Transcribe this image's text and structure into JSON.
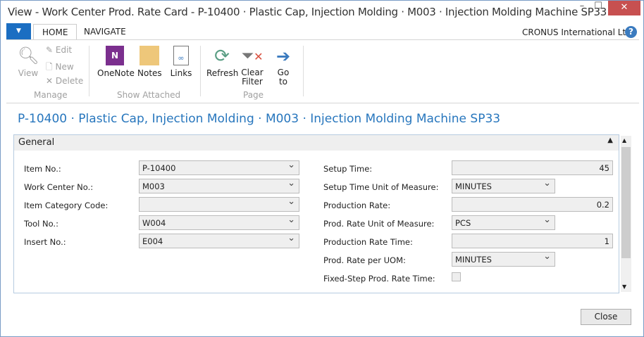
{
  "window": {
    "title": "View - Work Center Prod. Rate Card - P-10400 · Plastic Cap, Injection Molding · M003 · Injection Molding Machine SP33"
  },
  "ribbon": {
    "tabs": [
      "HOME",
      "NAVIGATE"
    ],
    "company": "CRONUS International Ltd.",
    "manage": {
      "view": "View",
      "edit": "Edit",
      "new": "New",
      "delete": "Delete",
      "group": "Manage"
    },
    "attached": {
      "onenote": "OneNote",
      "notes": "Notes",
      "links": "Links",
      "group": "Show Attached"
    },
    "page": {
      "refresh": "Refresh",
      "clear1": "Clear",
      "clear2": "Filter",
      "go1": "Go",
      "go2": "to",
      "group": "Page"
    }
  },
  "page_title": "P-10400 · Plastic Cap, Injection Molding · M003 · Injection Molding Machine SP33",
  "general": {
    "header": "General",
    "left": [
      {
        "label": "Item No.:",
        "value": "P-10400"
      },
      {
        "label": "Work Center No.:",
        "value": "M003"
      },
      {
        "label": "Item Category Code:",
        "value": ""
      },
      {
        "label": "Tool No.:",
        "value": "W004"
      },
      {
        "label": "Insert No.:",
        "value": "E004"
      }
    ],
    "right": [
      {
        "label": "Setup Time:",
        "value": "45"
      },
      {
        "label": "Setup Time Unit of Measure:",
        "value": "MINUTES"
      },
      {
        "label": "Production Rate:",
        "value": "0.2"
      },
      {
        "label": "Prod. Rate Unit of Measure:",
        "value": "PCS"
      },
      {
        "label": "Production Rate Time:",
        "value": "1"
      },
      {
        "label": "Prod. Rate per UOM:",
        "value": "MINUTES"
      },
      {
        "label": "Fixed-Step Prod. Rate Time:",
        "value": ""
      }
    ]
  },
  "footer": {
    "close": "Close"
  }
}
